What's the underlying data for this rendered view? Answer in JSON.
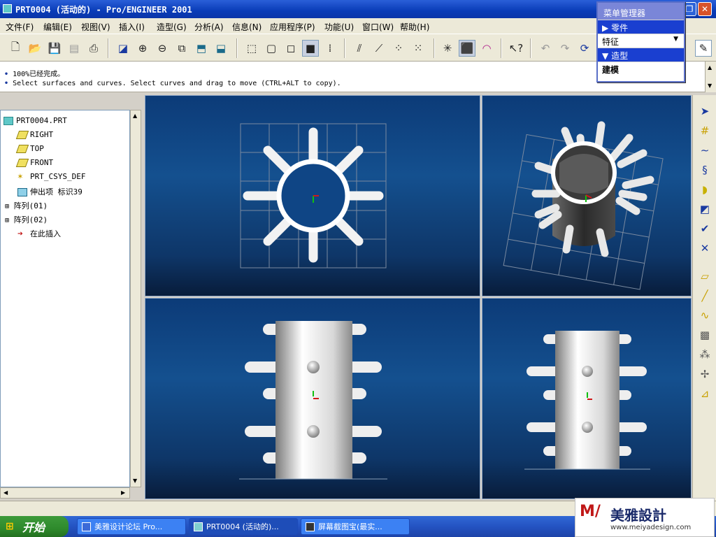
{
  "window": {
    "title": "PRT0004 (活动的) - Pro/ENGINEER 2001",
    "minimize": "_",
    "restore": "❐",
    "close": "✕"
  },
  "menubar": [
    {
      "label": "文件(F)"
    },
    {
      "label": "编辑(E)"
    },
    {
      "label": "视图(V)"
    },
    {
      "label": "插入(I)"
    },
    {
      "label": "造型(G)"
    },
    {
      "label": "分析(A)"
    },
    {
      "label": "信息(N)"
    },
    {
      "label": "应用程序(P)"
    },
    {
      "label": "功能(U)"
    },
    {
      "label": "窗口(W)"
    },
    {
      "label": "帮助(H)"
    }
  ],
  "messages": [
    "100%已经完成。",
    "Select surfaces and curves.  Select curves and drag to move (CTRL+ALT to copy)."
  ],
  "menu_manager": {
    "title": "菜单管理器",
    "part": "零件",
    "feature": "特征",
    "styling": "造型",
    "build": "建模"
  },
  "model_tree": [
    {
      "label": "PRT0004.PRT",
      "icon": "part-icon"
    },
    {
      "label": "RIGHT",
      "icon": "datum-plane-icon"
    },
    {
      "label": "TOP",
      "icon": "datum-plane-icon"
    },
    {
      "label": "FRONT",
      "icon": "datum-plane-icon"
    },
    {
      "label": "PRT_CSYS_DEF",
      "icon": "csys-icon"
    },
    {
      "label": "伸出项 标识39",
      "icon": "protrusion-icon"
    },
    {
      "label": "阵列(01)",
      "icon": "pattern-icon"
    },
    {
      "label": "阵列(02)",
      "icon": "pattern-icon"
    },
    {
      "label": "在此插入",
      "icon": "insert-here-icon"
    }
  ],
  "taskbar": {
    "start": "开始",
    "tasks": [
      {
        "label": "美雅设计论坛 Pro..."
      },
      {
        "label": "PRT0004 (活动的)..."
      },
      {
        "label": "屏幕截图宝(最实..."
      }
    ]
  },
  "brand": {
    "logo_text": "美雅設計",
    "url": "www.meiyadesign.com"
  },
  "colors": {
    "viewport_bg": "#14508f",
    "titlebar": "#0a3cb8",
    "accent_red": "#d01818",
    "axis_green": "#10c010"
  }
}
